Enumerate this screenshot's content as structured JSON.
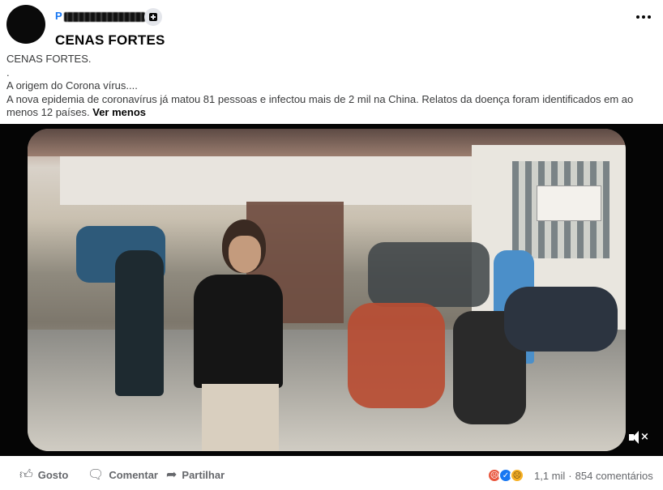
{
  "header": {
    "author_prefix": "P",
    "page_title": "CENAS FORTES"
  },
  "caption": {
    "lines": [
      "CENAS FORTES.",
      ".",
      "A origem do Corona vírus....",
      "A nova epidemia de coronavírus já matou 81 pessoas e infectou mais de 2 mil na China. Relatos da doença foram identificados em ao menos 12 países."
    ],
    "see_less": "Ver menos"
  },
  "video": {
    "muted": true,
    "icons": {
      "mute": "speaker-muted-icon"
    }
  },
  "footer": {
    "like_label": "Gosto",
    "comment_label": "Comentar",
    "share_label": "Partilhar",
    "reactions": [
      "angry",
      "like",
      "sad"
    ],
    "reaction_count": "1,1 mil",
    "comment_count": "854 comentários"
  },
  "colors": {
    "accent": "#1877f2",
    "text_secondary": "#65676b",
    "reaction_angry": "#e9573e",
    "reaction_like": "#1877f2",
    "reaction_sad": "#f7b125"
  }
}
